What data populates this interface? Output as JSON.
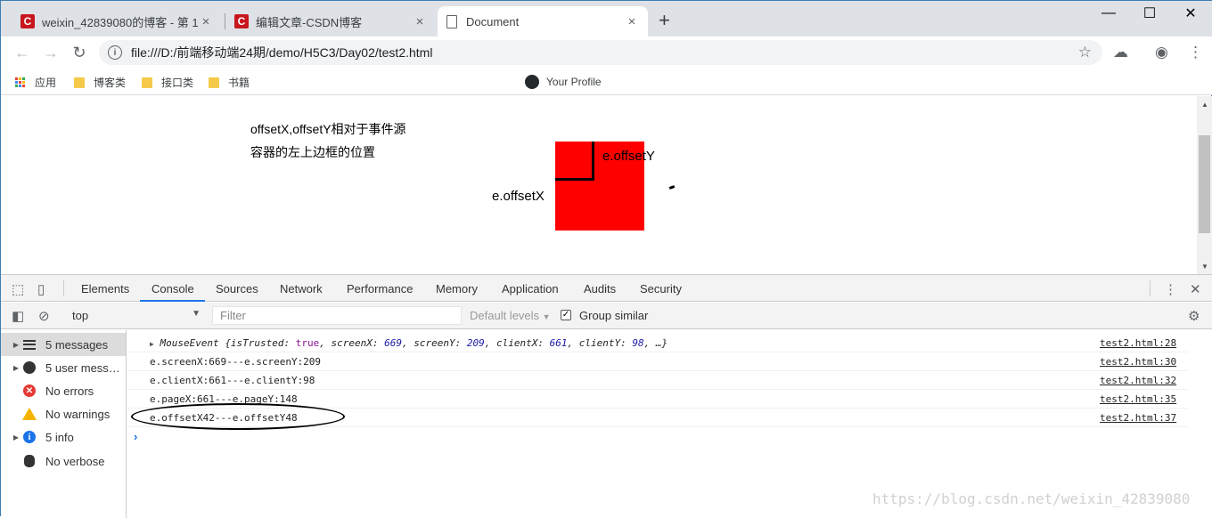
{
  "browser": {
    "tabs": [
      {
        "favicon": "C",
        "title": "weixin_42839080的博客 - 第 1"
      },
      {
        "favicon": "C",
        "title": "编辑文章-CSDN博客"
      },
      {
        "favicon": "document-icon",
        "title": "Document"
      }
    ],
    "tab_close": "×",
    "new_tab": "+",
    "window_controls": {
      "minimize": "—",
      "maximize": "☐",
      "close": "✕"
    },
    "url": "file:///D:/前端移动端24期/demo/H5C3/Day02/test2.html"
  },
  "bookmarks": [
    {
      "label": "应用"
    },
    {
      "label": "博客类"
    },
    {
      "label": "接口类"
    },
    {
      "label": "书籍"
    },
    {
      "label": "Your Profile"
    }
  ],
  "page": {
    "line1": "offsetX,offsetY相对于事件源",
    "line2": "容器的左上边框的位置",
    "label_y": "e.offsetY",
    "label_x": "e.offsetX",
    "box_color": "#ff0000"
  },
  "devtools": {
    "tabs": [
      "Elements",
      "Console",
      "Sources",
      "Network",
      "Performance",
      "Memory",
      "Application",
      "Audits",
      "Security"
    ],
    "active_tab": "Console",
    "context": "top",
    "filter_placeholder": "Filter",
    "levels": "Default levels",
    "group_similar": "Group similar",
    "sidebar": [
      {
        "label": "5 messages",
        "icon": "list-icon"
      },
      {
        "label": "5 user mess…",
        "icon": "user-icon"
      },
      {
        "label": "No errors",
        "icon": "error-icon"
      },
      {
        "label": "No warnings",
        "icon": "warning-icon"
      },
      {
        "label": "5 info",
        "icon": "info-icon"
      },
      {
        "label": "No verbose",
        "icon": "bug-icon"
      }
    ],
    "logs": [
      {
        "source": "test2.html:28"
      },
      {
        "msg": "e.screenX:669---e.screenY:209",
        "source": "test2.html:30"
      },
      {
        "msg": "e.clientX:661---e.clientY:98",
        "source": "test2.html:32"
      },
      {
        "msg": "e.pageX:661---e.pageY:148",
        "source": "test2.html:35"
      },
      {
        "msg": "e.offsetX42---e.offsetY48",
        "source": "test2.html:37"
      }
    ],
    "event": {
      "name": "MouseEvent",
      "isTrusted": "true",
      "screenX": "669",
      "screenY": "209",
      "clientX": "661",
      "clientY": "98"
    }
  },
  "watermark": "https://blog.csdn.net/weixin_42839080"
}
